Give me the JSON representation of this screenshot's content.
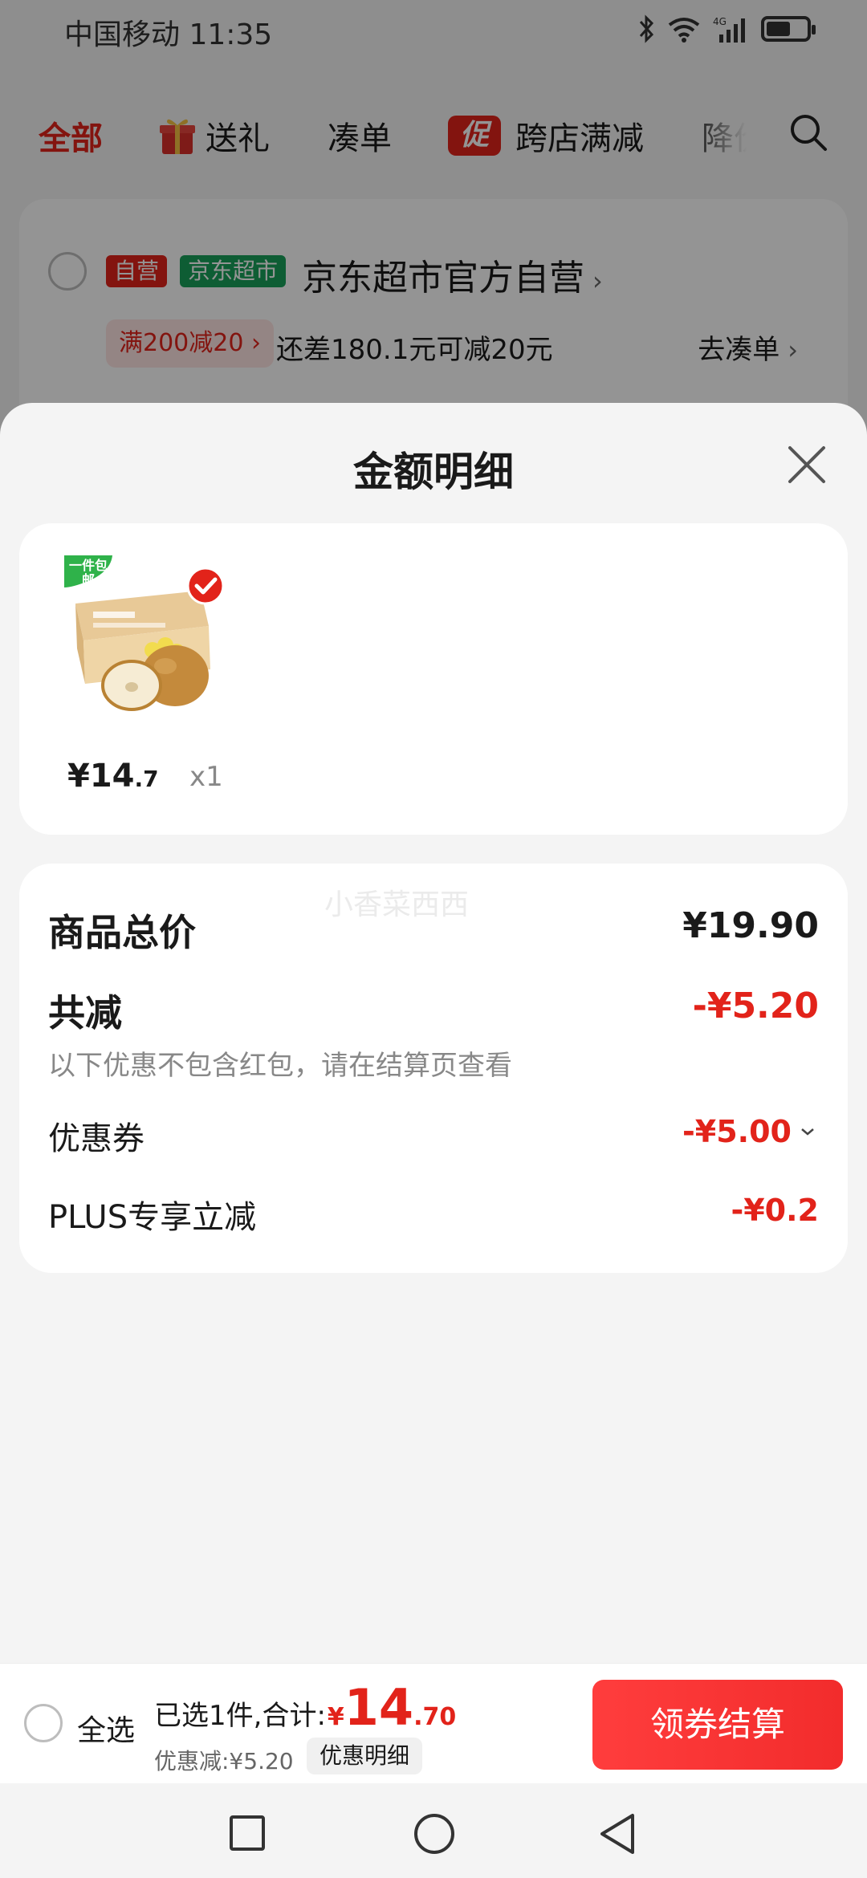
{
  "status_bar": {
    "carrier_time": "中国移动 11:35",
    "network": "4G",
    "battery_level": 0.6,
    "icons": [
      "bluetooth-icon",
      "wifi-icon",
      "signal-icon",
      "battery-icon"
    ]
  },
  "tabs": [
    {
      "label": "全部",
      "active": true
    },
    {
      "label": "送礼",
      "icon": "gift-icon"
    },
    {
      "label": "凑单"
    },
    {
      "label": "跨店满减",
      "badge": "促"
    },
    {
      "label": "降价"
    }
  ],
  "store": {
    "tag_self": "自营",
    "tag_market": "京东超市",
    "name": "京东超市官方自营",
    "promo_tag": "满200减20 ›",
    "promo_text": "还差180.1元可减20元",
    "go_combine": "去凑单"
  },
  "sheet": {
    "title": "金额明细",
    "product": {
      "badge": "一件包邮",
      "price_int": "¥14",
      "price_dec": ".7",
      "qty": "x1"
    },
    "watermark": "小香菜西西",
    "rows": {
      "total_label": "商品总价",
      "total_value": "¥19.90",
      "reduce_label": "共减",
      "reduce_value": "-¥5.20",
      "reduce_note": "以下优惠不包含红包，请在结算页查看",
      "coupon_label": "优惠券",
      "coupon_value": "-¥5.00",
      "plus_label": "PLUS专享立减",
      "plus_value": "-¥0.2"
    }
  },
  "bottom_bar": {
    "select_all": "全选",
    "selected_text": "已选1件,合计:",
    "total_currency": "¥",
    "total_int": "14",
    "total_dec": ".70",
    "discount_text": "优惠减:¥5.20",
    "detail_button": "优惠明细",
    "checkout_button": "领券结算"
  },
  "colors": {
    "accent_red": "#e2231a",
    "market_green": "#19a05a",
    "checkout_red": "#f22c2c"
  }
}
